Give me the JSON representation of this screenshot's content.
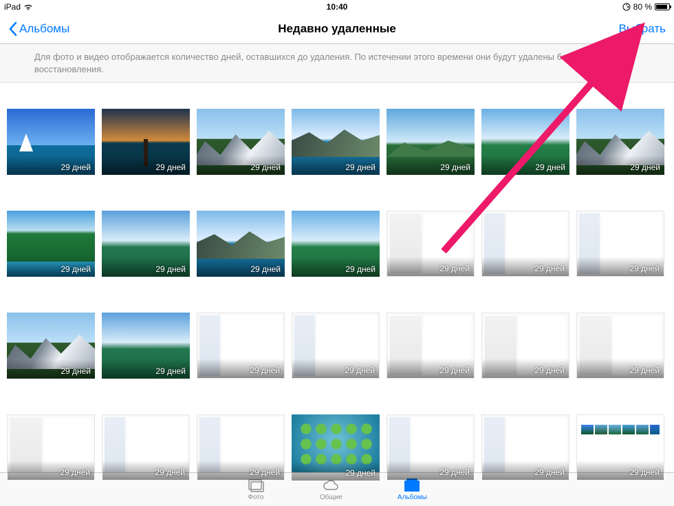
{
  "status": {
    "device": "iPad",
    "time": "10:40",
    "battery_pct": "80 %"
  },
  "nav": {
    "back_label": "Альбомы",
    "title": "Недавно удаленные",
    "select_label": "Выбрать"
  },
  "info_text": "Для фото и видео отображается количество дней, оставшихся до удаления. По истечении этого времени они будут удалены без возможности восстановления.",
  "days_label": "29 дней",
  "tabs": {
    "photos": "Фото",
    "shared": "Общие",
    "albums": "Альбомы"
  },
  "thumbs": [
    {
      "k": "sky-sea"
    },
    {
      "k": "pier"
    },
    {
      "k": "mount"
    },
    {
      "k": "lake"
    },
    {
      "k": "hill"
    },
    {
      "k": "valley"
    },
    {
      "k": "mount"
    },
    {
      "k": "forest"
    },
    {
      "k": "mount2"
    },
    {
      "k": "lake"
    },
    {
      "k": "valley"
    },
    {
      "k": "shot"
    },
    {
      "k": "shot2"
    },
    {
      "k": "shot2"
    },
    {
      "k": "mount"
    },
    {
      "k": "mount2"
    },
    {
      "k": "shot2"
    },
    {
      "k": "shot2"
    },
    {
      "k": "shot"
    },
    {
      "k": "shot"
    },
    {
      "k": "shot"
    },
    {
      "k": "shot"
    },
    {
      "k": "shot2"
    },
    {
      "k": "shot2"
    },
    {
      "k": "home"
    },
    {
      "k": "shot2"
    },
    {
      "k": "shot2"
    },
    {
      "k": "gallery"
    }
  ]
}
